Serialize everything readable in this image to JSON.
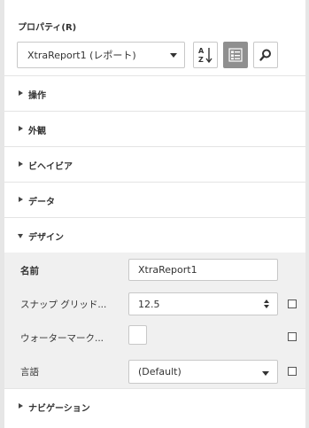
{
  "panel": {
    "title": "プロパティ(R)"
  },
  "toolbar": {
    "report_selector_value": "XtraReport1 (レポート)",
    "sort_button_icon": "sort-az-icon",
    "categorize_button_icon": "categorized-view-icon",
    "search_button_icon": "search-icon"
  },
  "categories": {
    "operation": "操作",
    "appearance": "外観",
    "behavior": "ビヘイビア",
    "data": "データ",
    "design": "デザイン",
    "navigation": "ナビゲーション"
  },
  "design_properties": {
    "name_label": "名前",
    "name_value": "XtraReport1",
    "snap_grid_label": "スナップ グリッド...",
    "snap_grid_value": "12.5",
    "watermark_label": "ウォーターマーク...",
    "language_label": "言語",
    "language_value": "(Default)"
  },
  "colors": {
    "active_button": "#8f8f8f",
    "property_area_background": "#f0f0f0",
    "border": "#c8c8c8"
  }
}
